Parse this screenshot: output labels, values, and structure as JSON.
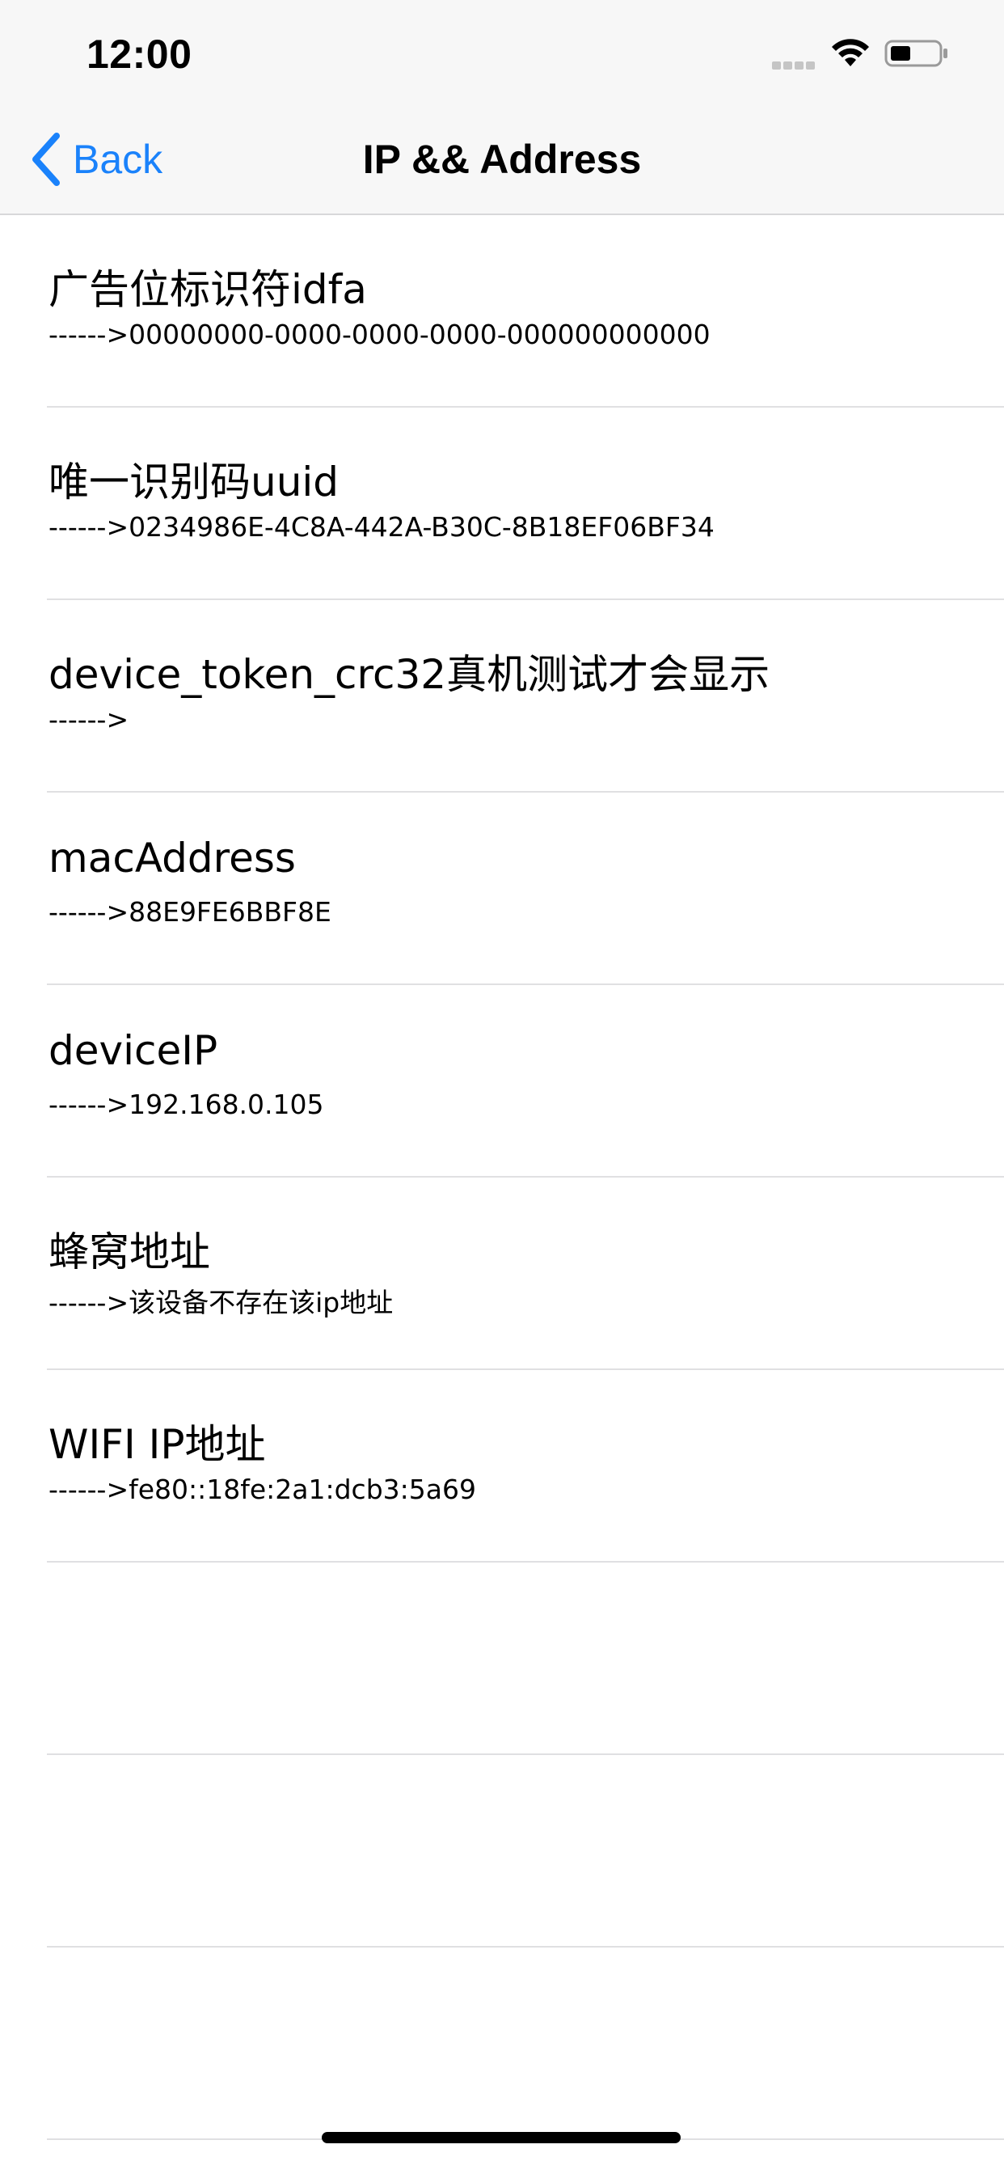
{
  "status_bar": {
    "time": "12:00",
    "icons": [
      "signal-icon",
      "wifi-icon",
      "battery-icon"
    ]
  },
  "nav_bar": {
    "back_label": "Back",
    "title": "IP && Address",
    "accent_color": "#1a82fb"
  },
  "list": {
    "rows": [
      {
        "title": "广告位标识符idfa",
        "subtitle": "------>00000000-0000-0000-0000-000000000000"
      },
      {
        "title": "唯一识别码uuid",
        "subtitle": "------>0234986E-4C8A-442A-B30C-8B18EF06BF34"
      },
      {
        "title": "device_token_crc32真机测试才会显示",
        "subtitle": "------>"
      },
      {
        "title": "macAddress",
        "subtitle": "------>88E9FE6BBF8E"
      },
      {
        "title": "deviceIP",
        "subtitle": "------>192.168.0.105"
      },
      {
        "title": "蜂窝地址",
        "subtitle": "------>该设备不存在该ip地址"
      },
      {
        "title": "WIFI IP地址",
        "subtitle": "------>fe80::18fe:2a1:dcb3:5a69"
      },
      {
        "title": "",
        "subtitle": ""
      },
      {
        "title": "",
        "subtitle": ""
      },
      {
        "title": "",
        "subtitle": ""
      }
    ]
  }
}
